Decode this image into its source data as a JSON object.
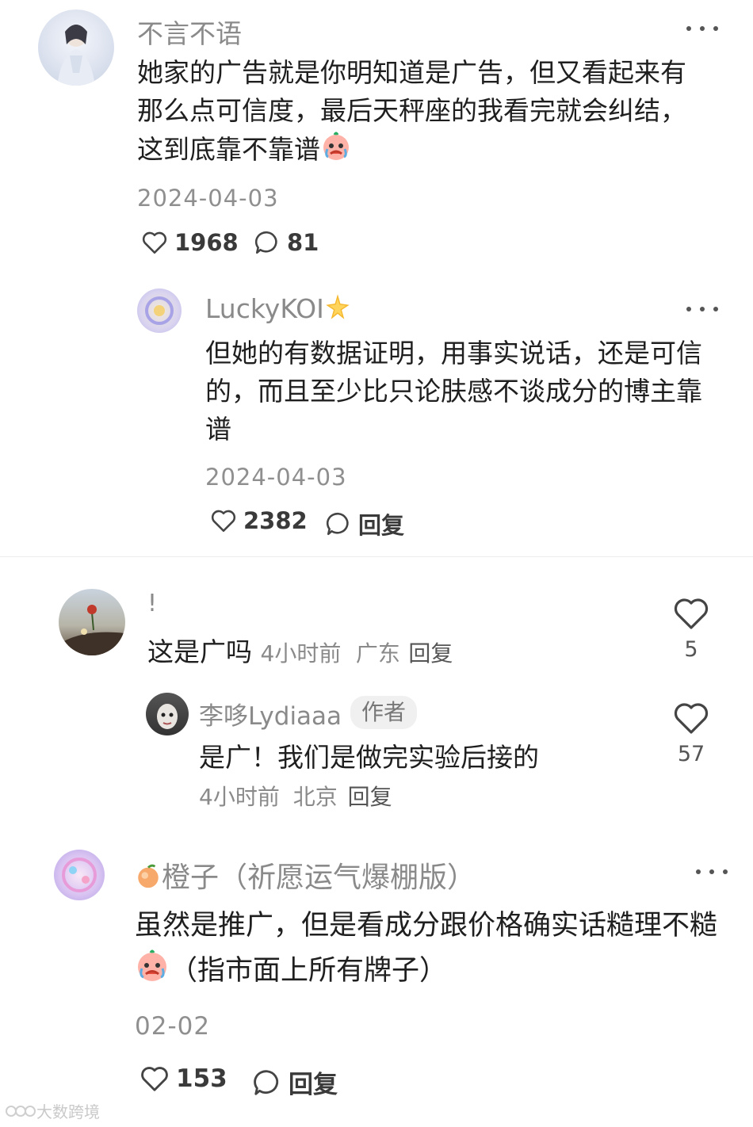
{
  "comments": [
    {
      "username": "不言不语",
      "content": "她家的广告就是你明知道是广告，但又看起来有那么点可信度，最后天秤座的我看完就会纠结，这到底靠不靠谱",
      "date": "2024-04-03",
      "likes": "1968",
      "replies": "81",
      "avatar_icon": "avatar-icon"
    },
    {
      "username": "LuckyKOI",
      "content": "但她的有数据证明，用事实说话，还是可信的，而且至少比只论肤感不谈成分的博主靠谱",
      "date": "2024-04-03",
      "likes": "2382",
      "reply_label": "回复"
    },
    {
      "username": "!",
      "content": "这是广吗",
      "time": "4小时前",
      "location": "广东",
      "reply_label": "回复",
      "likes": "5"
    },
    {
      "username": "李哆Lydiaaa",
      "badge": "作者",
      "content": "是广！我们是做完实验后接的",
      "time": "4小时前",
      "location": "北京",
      "reply_label": "回复",
      "likes": "57"
    },
    {
      "username": "橙子（祈愿运气爆棚版）",
      "content_part1": "虽然是推广，但是看成分跟价格确实话糙理不糙",
      "content_part2": "（指市面上所有牌子）",
      "date": "02-02",
      "likes": "153",
      "reply_label": "回复"
    }
  ],
  "watermark": "大数跨境",
  "colors": {
    "username": "#8a8a8a",
    "text": "#1f1f1f",
    "meta": "#8f8f8f"
  }
}
